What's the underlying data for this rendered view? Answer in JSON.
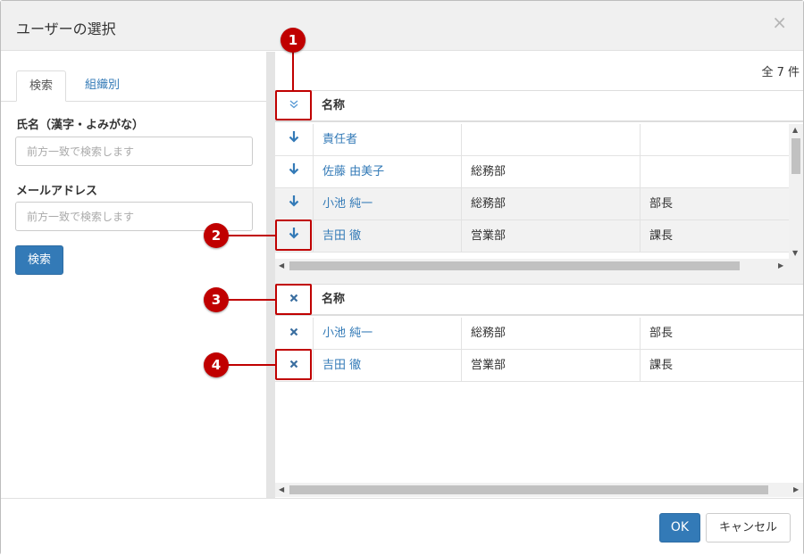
{
  "dialog": {
    "title": "ユーザーの選択",
    "close_symbol": "×"
  },
  "left": {
    "tabs": [
      {
        "label": "検索"
      },
      {
        "label": "組織別"
      }
    ],
    "name_label": "氏名（漢字・よみがな）",
    "name_placeholder": "前方一致で検索します",
    "email_label": "メールアドレス",
    "email_placeholder": "前方一致で検索します",
    "search_button": "検索"
  },
  "results": {
    "count_text": "全 7 件",
    "header_name": "名称",
    "header_icon": "chevron-double-down-icon",
    "rows": [
      {
        "name": "責任者",
        "dept": "",
        "title": ""
      },
      {
        "name": "佐藤 由美子",
        "dept": "総務部",
        "title": ""
      },
      {
        "name": "小池 純一",
        "dept": "総務部",
        "title": "部長"
      },
      {
        "name": "吉田 徹",
        "dept": "営業部",
        "title": "課長"
      }
    ]
  },
  "selected": {
    "header_name": "名称",
    "rows": [
      {
        "name": "小池 純一",
        "dept": "総務部",
        "title": "部長"
      },
      {
        "name": "吉田 徹",
        "dept": "営業部",
        "title": "課長"
      }
    ]
  },
  "footer": {
    "ok_label": "OK",
    "cancel_label": "キャンセル"
  },
  "callouts": [
    "1",
    "2",
    "3",
    "4"
  ],
  "colors": {
    "accent": "#337ab7",
    "callout": "#c00000"
  }
}
